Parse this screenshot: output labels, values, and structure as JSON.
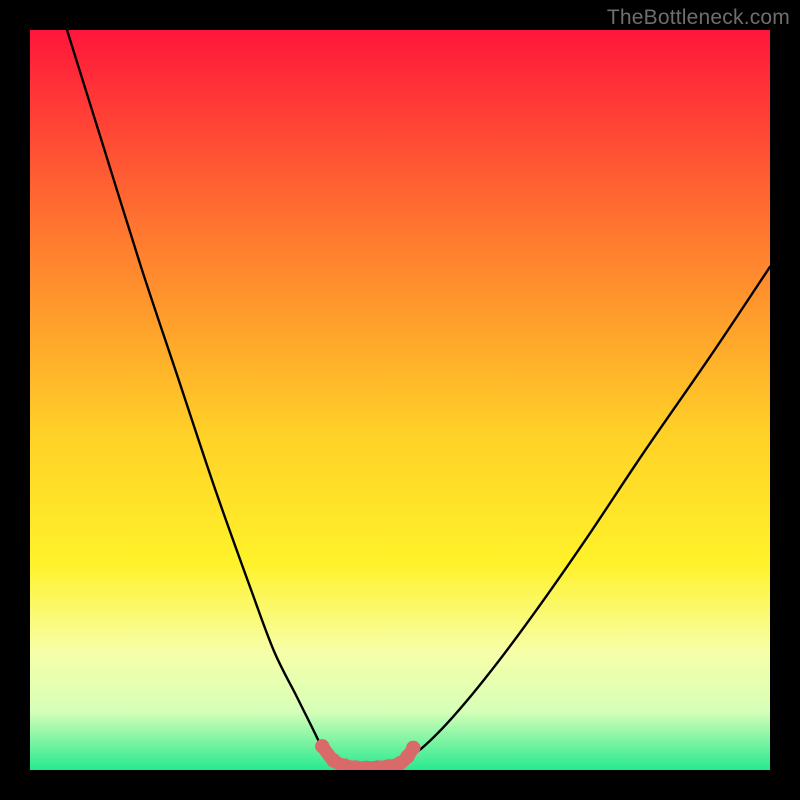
{
  "watermark": {
    "text": "TheBottleneck.com"
  },
  "colors": {
    "black": "#000000",
    "curve": "#000000",
    "marker_fill": "#da6a6a",
    "marker_stroke": "#c85a5a",
    "grad_top": "#ff163b",
    "grad_mid1": "#ff7a2f",
    "grad_mid2": "#ffd227",
    "grad_mid3": "#fff22a",
    "grad_mid4": "#f7ffa8",
    "grad_mid5": "#d7ffb8",
    "grad_bottom": "#27e98f"
  },
  "chart_data": {
    "type": "line",
    "title": "",
    "xlabel": "",
    "ylabel": "",
    "xlim": [
      0,
      100
    ],
    "ylim": [
      0,
      100
    ],
    "grid": false,
    "legend": false,
    "series": [
      {
        "name": "left_curve",
        "x": [
          5,
          10,
          15,
          20,
          25,
          30,
          33,
          36,
          38,
          39.5,
          41
        ],
        "y": [
          100,
          84,
          68,
          53,
          38,
          24,
          16,
          10,
          6,
          3,
          1
        ]
      },
      {
        "name": "right_curve",
        "x": [
          50,
          53,
          57,
          62,
          68,
          75,
          83,
          92,
          100
        ],
        "y": [
          1,
          3,
          7,
          13,
          21,
          31,
          43,
          56,
          68
        ]
      }
    ],
    "markers": {
      "name": "valley_markers",
      "x": [
        39.5,
        41,
        42.5,
        44,
        45.5,
        47,
        48.5,
        50,
        51,
        51.8
      ],
      "y": [
        3.2,
        1.3,
        0.6,
        0.35,
        0.3,
        0.35,
        0.5,
        0.9,
        1.8,
        3.0
      ]
    },
    "gradient_stops": [
      {
        "offset": 0.0,
        "color": "#ff163b"
      },
      {
        "offset": 0.28,
        "color": "#ff7a2f"
      },
      {
        "offset": 0.55,
        "color": "#ffd227"
      },
      {
        "offset": 0.72,
        "color": "#fff22a"
      },
      {
        "offset": 0.84,
        "color": "#f7ffa8"
      },
      {
        "offset": 0.92,
        "color": "#d7ffb8"
      },
      {
        "offset": 1.0,
        "color": "#27e98f"
      }
    ]
  }
}
